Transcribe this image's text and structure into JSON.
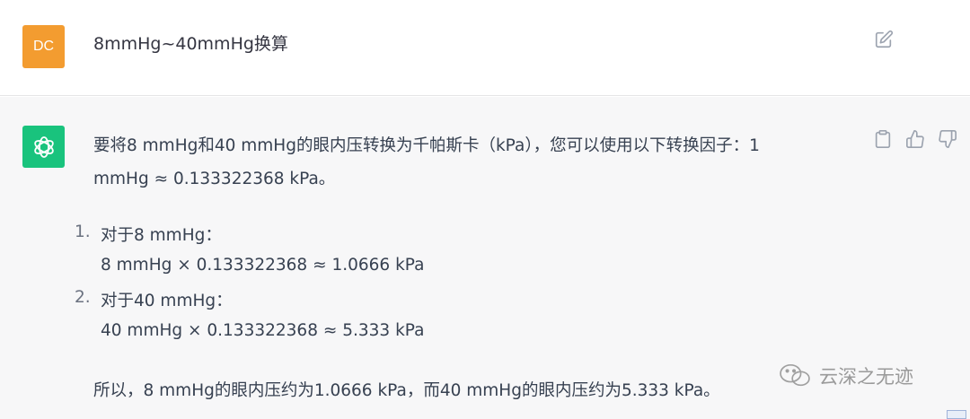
{
  "user": {
    "avatar_initials": "DC",
    "avatar_color": "#f39c30",
    "message": "8mmHg~40mmHg换算",
    "edit_icon": "edit-icon"
  },
  "assistant": {
    "avatar_color": "#19c37d",
    "avatar_icon": "openai-logo-icon",
    "actions": [
      "clipboard-icon",
      "thumbs-up-icon",
      "thumbs-down-icon"
    ],
    "intro_line1": "要将8 mmHg和40 mmHg的眼内压转换为千帕斯卡（kPa），您可以使用以下转换因子：1",
    "intro_line2": "mmHg ≈ 0.133322368 kPa。",
    "items": [
      {
        "number": "1.",
        "title": "对于8 mmHg：",
        "calc": "8 mmHg × 0.133322368 ≈ 1.0666 kPa"
      },
      {
        "number": "2.",
        "title": "对于40 mmHg：",
        "calc": "40 mmHg × 0.133322368 ≈ 5.333 kPa"
      }
    ],
    "conclusion": "所以，8 mmHg的眼内压约为1.0666 kPa，而40 mmHg的眼内压约为5.333 kPa。"
  },
  "watermark": {
    "text": "云深之无迹",
    "icon": "wechat-icon"
  }
}
